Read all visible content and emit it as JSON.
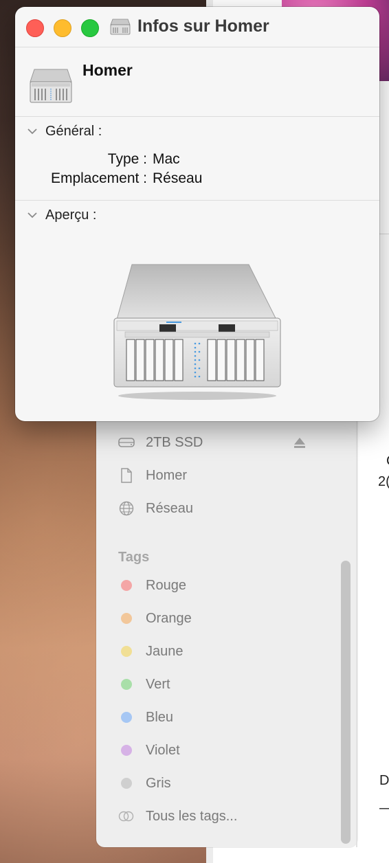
{
  "info_window": {
    "title": "Infos sur Homer",
    "name": "Homer",
    "general": {
      "header": "Général :",
      "rows": [
        {
          "label": "Type :",
          "value": "Mac"
        },
        {
          "label": "Emplacement :",
          "value": "Réseau"
        }
      ]
    },
    "preview": {
      "header": "Aperçu :"
    },
    "icon": "server-rack-icon"
  },
  "sidebar": {
    "locations": [
      {
        "label": "2TB SSD",
        "icon": "drive-icon",
        "ejectable": true
      },
      {
        "label": "Homer",
        "icon": "document-icon"
      },
      {
        "label": "Réseau",
        "icon": "globe-icon"
      }
    ],
    "tags_title": "Tags",
    "tags": [
      {
        "label": "Rouge",
        "color": "#f4a6a6"
      },
      {
        "label": "Orange",
        "color": "#f2c79a"
      },
      {
        "label": "Jaune",
        "color": "#f1df95"
      },
      {
        "label": "Vert",
        "color": "#a9dfa9"
      },
      {
        "label": "Bleu",
        "color": "#a6c7f4"
      },
      {
        "label": "Violet",
        "color": "#d6b2e6"
      },
      {
        "label": "Gris",
        "color": "#cfcfcf"
      }
    ],
    "all_tags": "Tous les tags..."
  },
  "background_fragments": {
    "frag1": "C",
    "frag2": "2(",
    "frag3": "D",
    "frag4": "—"
  }
}
